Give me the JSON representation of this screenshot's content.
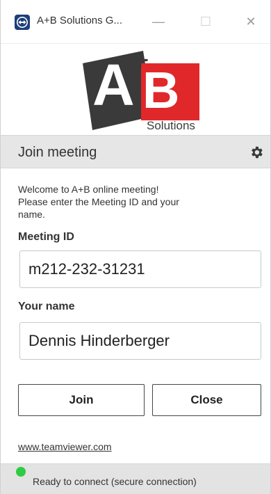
{
  "window": {
    "title": "A+B Solutions G...",
    "minimize_glyph": "—",
    "maximize_glyph": "☐",
    "close_glyph": "✕"
  },
  "logo": {
    "letter_a": "A",
    "plus": "+",
    "letter_b": "B",
    "tagline": "Solutions",
    "colors": {
      "dark": "#3a3a3a",
      "red": "#e0282b"
    }
  },
  "section": {
    "title": "Join meeting",
    "settings_icon": "gear-icon"
  },
  "welcome": {
    "lines": [
      "Welcome to A+B online meeting!",
      "Please enter the Meeting ID and your",
      "name."
    ]
  },
  "form": {
    "meeting_id_label": "Meeting ID",
    "meeting_id_value": "m212-232-31231",
    "name_label": "Your name",
    "name_value": "Dennis Hinderberger"
  },
  "buttons": {
    "join": "Join",
    "close": "Close"
  },
  "footer": {
    "link": "www.teamviewer.com"
  },
  "status": {
    "text": "Ready to connect (secure connection)",
    "color": "#2ecc40"
  }
}
